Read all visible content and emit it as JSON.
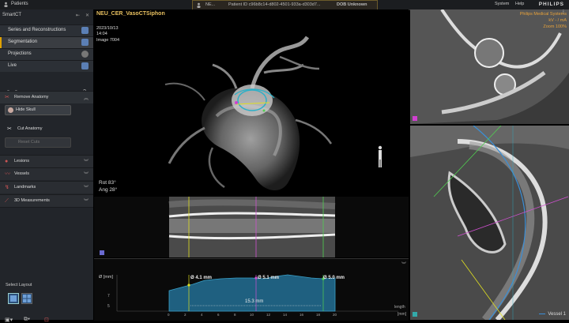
{
  "topbar": {
    "patients_label": "Patients",
    "window_label": "NE...",
    "patient_id": "Patient ID c96b8c14-d802-4501-933a-d303d7...",
    "dob": "DOB Unknown",
    "system": "System",
    "help": "Help",
    "brand": "PHILIPS"
  },
  "sidebar": {
    "title": "SmartCT",
    "steps": [
      {
        "label": "Series and Reconstructions"
      },
      {
        "label": "Segmentation"
      },
      {
        "label": "Projections"
      },
      {
        "label": "Live"
      }
    ],
    "remove_anatomy": "Remove Anatomy",
    "hide_skull": "Hide Skull",
    "cut_anatomy": "Cut Anatomy",
    "reset_cuts": "Reset Cuts",
    "sections": [
      {
        "label": "Lesions"
      },
      {
        "label": "Vessels"
      },
      {
        "label": "Landmarks"
      },
      {
        "label": "3D Measurements"
      }
    ],
    "select_layout": "Select Layout"
  },
  "viewport3d": {
    "series_title": "NEU_CER_VasoCTSiphon",
    "date": "2023/10/13",
    "time": "14:04",
    "image": "Image 7004",
    "rot": "Rot 83°",
    "ang": "Ang 28°",
    "vendor": "Philips Medical Systems",
    "kv": "kV - / mA",
    "zoom": "Zoom 100%"
  },
  "graph": {
    "y_axis_label": "Ø [mm]",
    "ticks_y": [
      "7",
      "5"
    ],
    "ticks_x": [
      "0",
      "2",
      "4",
      "6",
      "8",
      "10",
      "12",
      "14",
      "16",
      "18",
      "20"
    ],
    "x_axis_label_1": "length",
    "x_axis_label_2": "[mm]",
    "m1": "Ø 4.1 mm",
    "m2": "Ø 5.1 mm",
    "m3": "Ø 5.0 mm",
    "length": "15.3 mm"
  },
  "vessel_label": "Vessel 1"
}
